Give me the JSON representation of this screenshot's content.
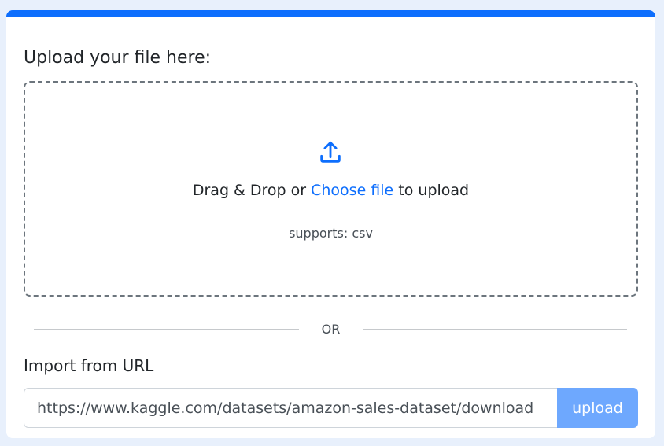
{
  "upload": {
    "title": "Upload your file here:",
    "icon": "upload-icon",
    "drag_prefix": "Drag & Drop or ",
    "choose_link": "Choose file",
    "drag_suffix": " to upload",
    "supports": "supports: csv"
  },
  "divider": {
    "label": "OR"
  },
  "import": {
    "label": "Import from URL",
    "url_value": "https://www.kaggle.com/datasets/amazon-sales-dataset/download",
    "button_label": "upload"
  },
  "colors": {
    "accent": "#0d6efd",
    "button_bg": "#6ea8fe",
    "page_bg": "#e8f0fc"
  }
}
